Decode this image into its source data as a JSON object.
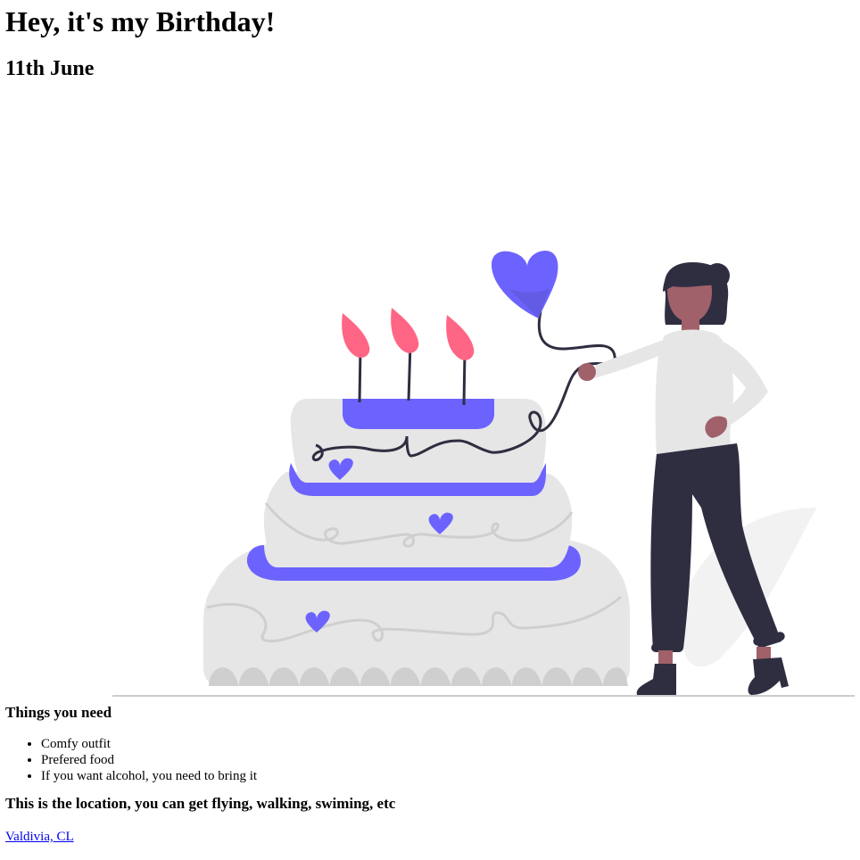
{
  "header": {
    "title": "Hey, it's my Birthday!",
    "date": "11th June"
  },
  "illustration": {
    "icon": "birthday-cake-woman-balloon-illustration",
    "colors": {
      "accent": "#6c63ff",
      "flame": "#ff6584",
      "cake": "#e6e6e6",
      "decoration": "#cfcfcf",
      "dark": "#2f2e41",
      "skin": "#a0616a",
      "ground": "#cccccc"
    }
  },
  "needs": {
    "title": "Things you need",
    "items": [
      "Comfy outfit",
      "Prefered food",
      "If you want alcohol, you need to bring it"
    ]
  },
  "location": {
    "title": "This is the location, you can get flying, walking, swiming, etc",
    "link_label": "Valdivia, CL"
  }
}
